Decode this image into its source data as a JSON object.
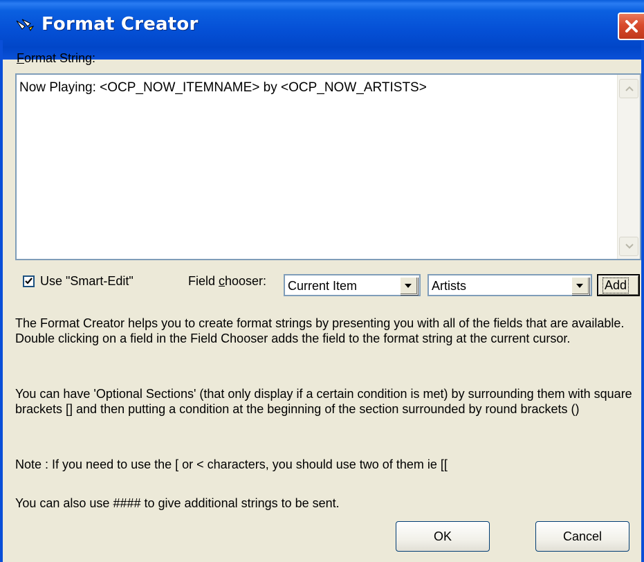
{
  "window": {
    "title": "Format Creator",
    "close_icon": "close-icon",
    "app_icon": "wand-icon"
  },
  "format_string": {
    "label_hotkey": "F",
    "label_rest": "ormat String:",
    "value": "Now Playing: <OCP_NOW_ITEMNAME> by <OCP_NOW_ARTISTS>"
  },
  "smart_edit": {
    "label": "Use \"Smart-Edit\"",
    "checked": true
  },
  "field_chooser": {
    "label_pre": "Field ",
    "label_hotkey": "c",
    "label_post": "hooser:",
    "category_value": "Current Item",
    "field_value": "Artists",
    "add_label": "Add"
  },
  "help": {
    "p1": "The Format Creator helps you to create format strings by presenting you with all of the fields that are available. Double clicking on a field in the Field Chooser adds the field to the format string at the current cursor.",
    "p2": "You can have 'Optional Sections' (that only display if a certain condition is met) by surrounding them with square brackets [] and then putting a condition at the beginning of the section surrounded by round brackets ()",
    "p3": "Note : If you need to use the [ or < characters, you should use two of them ie [[",
    "p4": "You can also use #### to give additional strings to be sent."
  },
  "buttons": {
    "ok": "OK",
    "cancel": "Cancel"
  },
  "colors": {
    "titlebar": "#0550d6",
    "dialog_bg": "#ece9d8",
    "close_red": "#d84a2c"
  }
}
